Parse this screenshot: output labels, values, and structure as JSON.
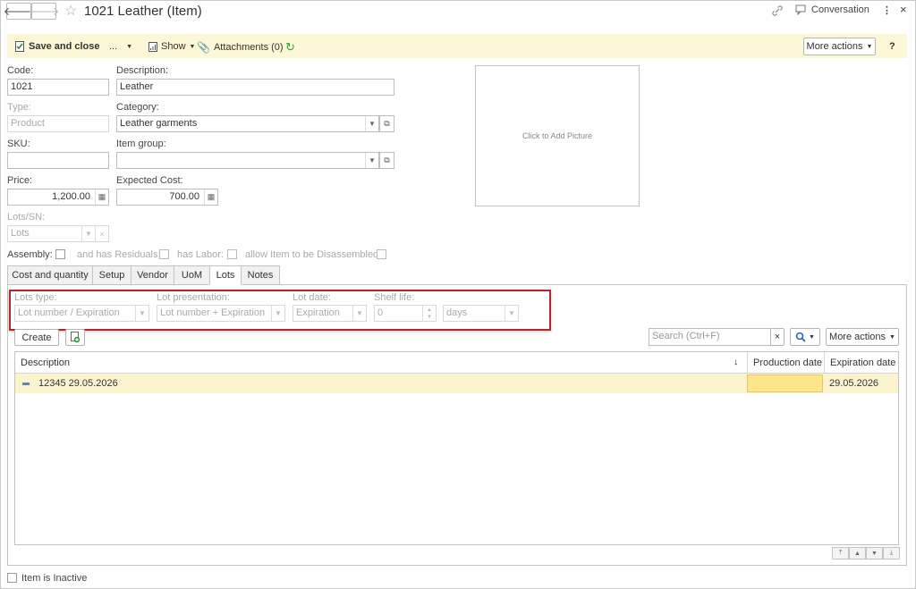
{
  "header": {
    "title": "1021 Leather (Item)",
    "conversation_label": "Conversation"
  },
  "toolbar": {
    "save_close": "Save and close",
    "ellipsis": "...",
    "show": "Show",
    "attachments": "Attachments (0)",
    "more_actions": "More actions",
    "help": "?"
  },
  "form": {
    "code_label": "Code:",
    "code_value": "1021",
    "description_label": "Description:",
    "description_value": "Leather",
    "type_label": "Type:",
    "type_value": "Product",
    "category_label": "Category:",
    "category_value": "Leather garments",
    "sku_label": "SKU:",
    "sku_value": "",
    "item_group_label": "Item group:",
    "item_group_value": "",
    "price_label": "Price:",
    "price_value": "1,200.00",
    "expected_cost_label": "Expected Cost:",
    "expected_cost_value": "700.00",
    "lots_sn_label": "Lots/SN:",
    "lots_sn_value": "Lots",
    "assembly_label": "Assembly:",
    "has_residuals_label": "and has Residuals:",
    "has_labor_label": "has Labor:",
    "disassemble_label": "allow Item to be Disassembled:",
    "picture_text": "Click to Add Picture"
  },
  "tabs": [
    {
      "label": "Cost and quantity"
    },
    {
      "label": "Setup"
    },
    {
      "label": "Vendor"
    },
    {
      "label": "UoM"
    },
    {
      "label": "Lots"
    },
    {
      "label": "Notes"
    }
  ],
  "lots": {
    "lots_type_label": "Lots type:",
    "lots_type_value": "Lot number / Expiration",
    "lot_presentation_label": "Lot presentation:",
    "lot_presentation_value": "Lot number + Expiration",
    "lot_date_label": "Lot date:",
    "lot_date_value": "Expiration",
    "shelf_life_label": "Shelf life:",
    "shelf_life_value": "0",
    "shelf_life_unit": "days",
    "create_button": "Create",
    "search_placeholder": "Search (Ctrl+F)",
    "search_clear": "×",
    "more_actions": "More actions"
  },
  "grid": {
    "columns": [
      "Description",
      "Production date",
      "Expiration date"
    ],
    "sort_indicator": "↓",
    "rows": [
      {
        "description": "12345 29.05.2026",
        "production_date": "",
        "expiration_date": "29.05.2026"
      }
    ]
  },
  "footer": {
    "inactive_label": "Item is Inactive"
  }
}
